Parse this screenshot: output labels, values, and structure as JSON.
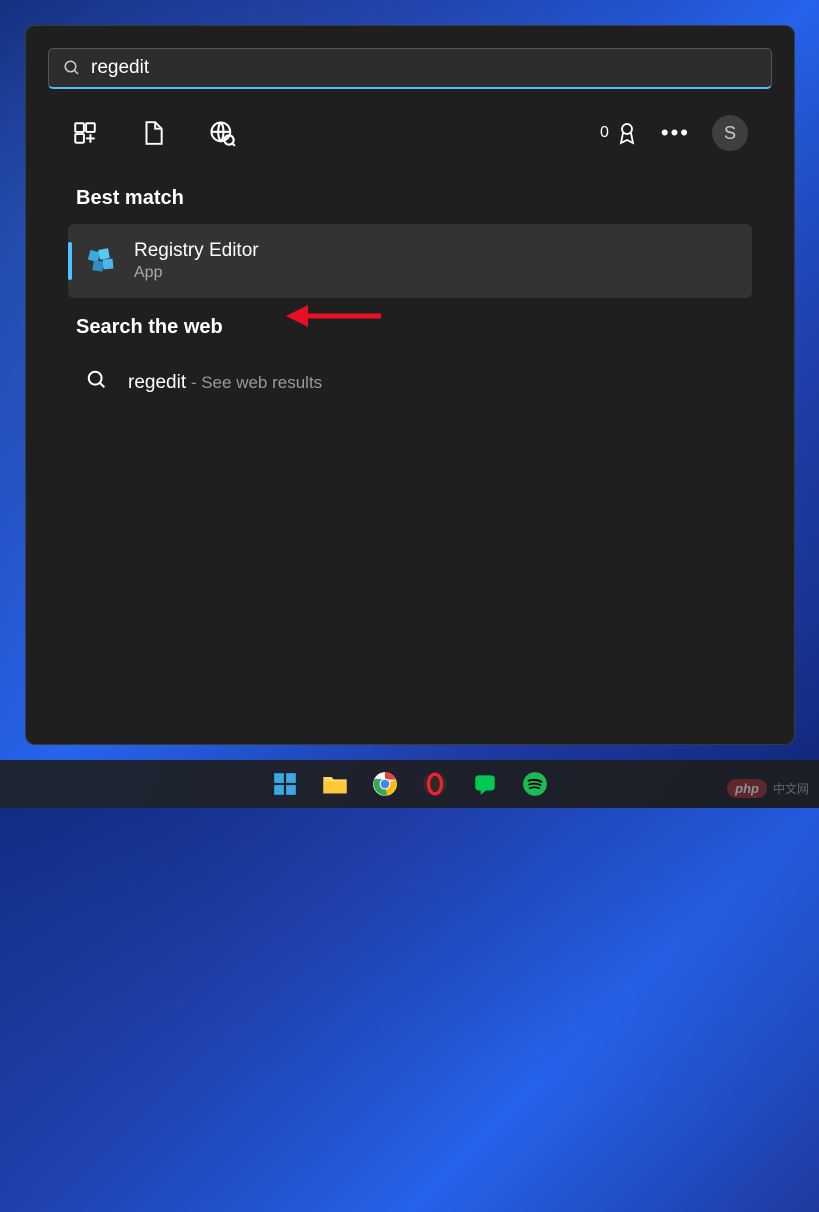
{
  "search": {
    "value": "regedit"
  },
  "toolbar": {
    "rewards_count": "0"
  },
  "avatar": {
    "initial": "S"
  },
  "sections": {
    "best_match": "Best match",
    "search_web": "Search the web"
  },
  "results": {
    "best": {
      "title": "Registry Editor",
      "subtitle": "App"
    },
    "web": {
      "query": "regedit",
      "suffix": " - See web results"
    }
  },
  "watermark": {
    "badge": "php",
    "text": "中文网"
  }
}
